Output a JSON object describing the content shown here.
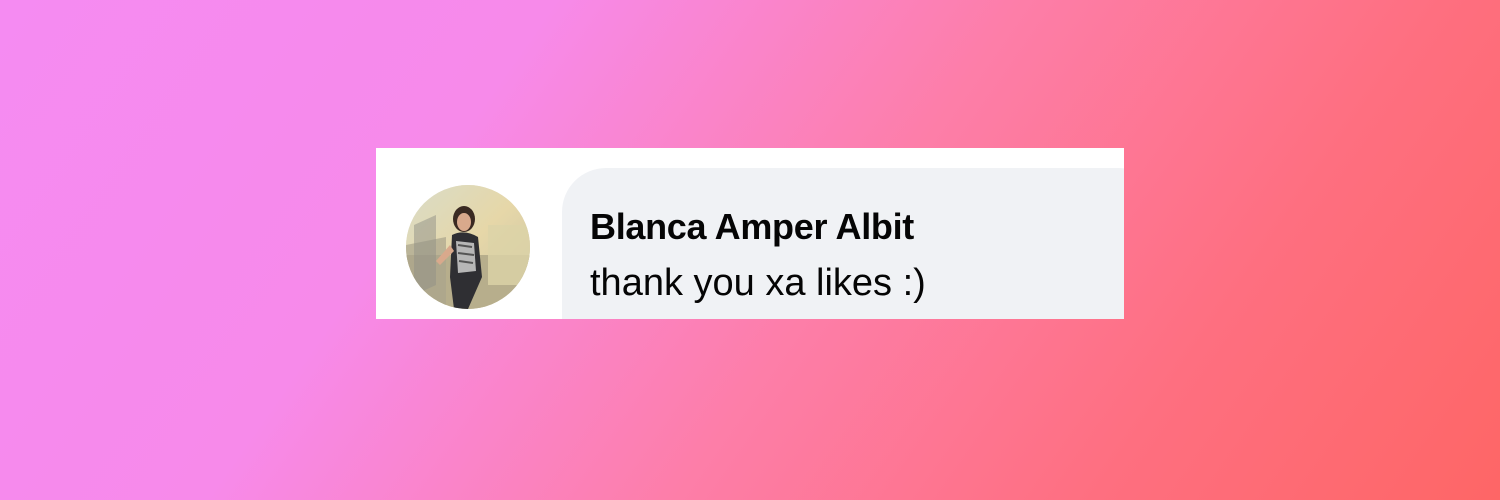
{
  "comment": {
    "author_name": "Blanca Amper Albit",
    "text": "thank you xa likes :)",
    "avatar_icon": "user-photo-avatar"
  },
  "colors": {
    "background_gradient_start": "#f58bf2",
    "background_gradient_end": "#fe6666",
    "card_background": "#ffffff",
    "bubble_background": "#f0f2f5",
    "text_color": "#050505"
  }
}
